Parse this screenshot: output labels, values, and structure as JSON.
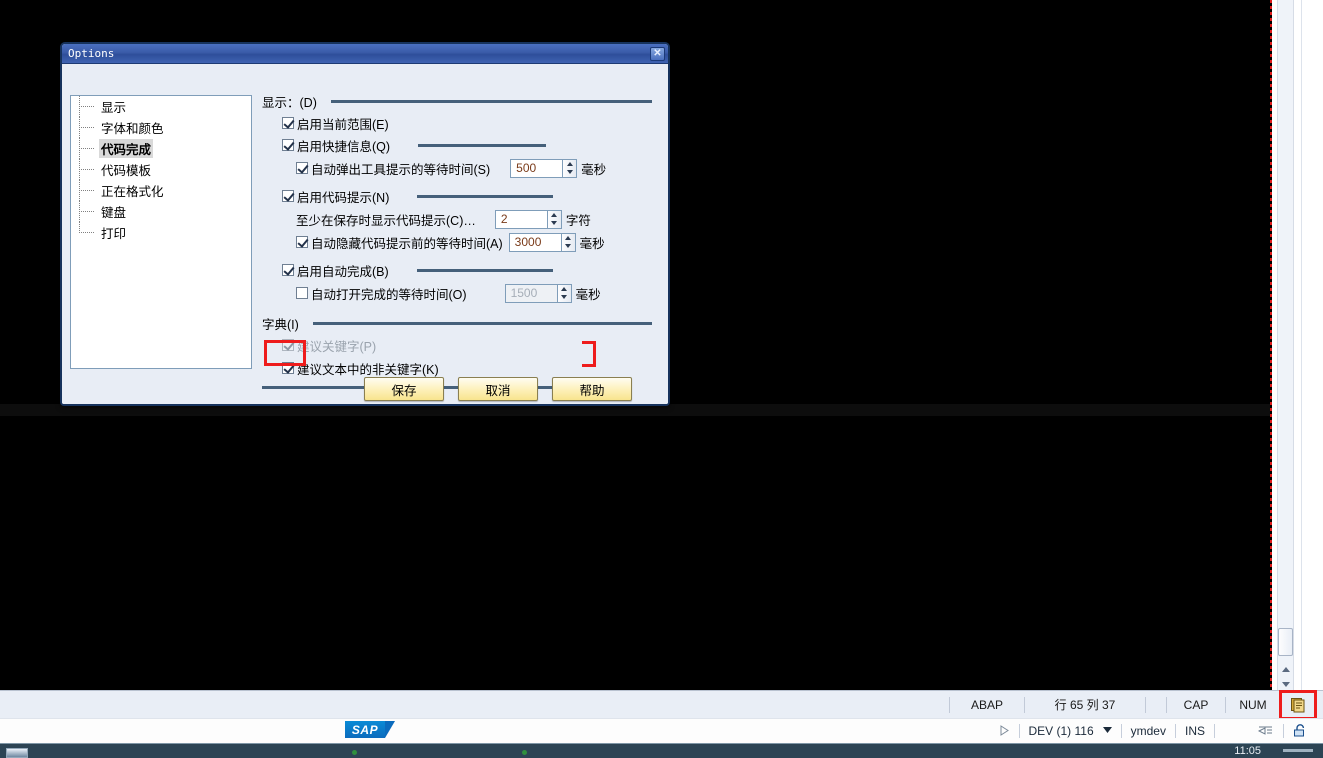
{
  "dialog": {
    "title": "Options",
    "close_label": "✕",
    "tree": [
      {
        "label": "显示",
        "selected": false
      },
      {
        "label": "字体和颜色",
        "selected": false
      },
      {
        "label": "代码完成",
        "selected": true
      },
      {
        "label": "代码模板",
        "selected": false
      },
      {
        "label": "正在格式化",
        "selected": false
      },
      {
        "label": "键盘",
        "selected": false
      },
      {
        "label": "打印",
        "selected": false
      }
    ],
    "display_group": {
      "title": "显示：(D)",
      "enable_current_scope": "启用当前范围(E)",
      "enable_quick_info": "启用快捷信息(Q)",
      "tooltip_delay_label": "自动弹出工具提示的等待时间(S)",
      "tooltip_delay_value": "500",
      "tooltip_delay_unit": "毫秒",
      "enable_code_hint": "启用代码提示(N)",
      "min_chars_label": "至少在保存时显示代码提示(C)…",
      "min_chars_value": "2",
      "min_chars_unit": "字符",
      "autohide_label": "自动隐藏代码提示前的等待时间(A)",
      "autohide_value": "3000",
      "autohide_unit": "毫秒",
      "enable_autocomplete": "启用自动完成(B)",
      "autoopen_label": "自动打开完成的等待时间(O)",
      "autoopen_value": "1500",
      "autoopen_unit": "毫秒"
    },
    "dictionary_group": {
      "title": "字典(I)",
      "suggest_keywords": "建议关键字(P)",
      "suggest_non_keywords": "建议文本中的非关键字(K)"
    },
    "buttons": {
      "save": "保存",
      "cancel": "取消",
      "help": "帮助"
    }
  },
  "status_bar": {
    "language": "ABAP",
    "position": "行 65 列 37",
    "caps": "CAP",
    "num": "NUM",
    "icon": "clipboard-icon"
  },
  "sap_bar": {
    "run_icon": "play-icon",
    "system": "DEV (1) 116",
    "dropdown_icon": "chevron-down-icon",
    "user": "ymdev",
    "insert_mode": "INS",
    "tab_icon": "tab-indent-icon",
    "lock_icon": "unlock-icon",
    "logo": "SAP"
  },
  "taskbar": {
    "clock": "11:05",
    "start_icon": "start-button-icon"
  },
  "colors": {
    "accent_blue": "#3a5ba8",
    "dialog_bg": "#e8edf5",
    "rule": "#45607a",
    "button_yellow": "#fdf0b8",
    "annotation_red": "#ee1c1c",
    "sap_blue": "#0b6bbd"
  }
}
